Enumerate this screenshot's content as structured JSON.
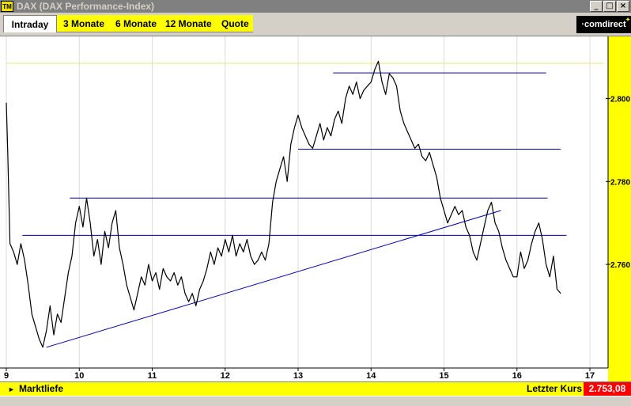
{
  "window": {
    "title": "DAX (DAX Performance-Index)",
    "icon": "TM",
    "controls": [
      "minimize",
      "maximize",
      "close"
    ]
  },
  "tabs": [
    {
      "label": "Intraday",
      "active": true
    },
    {
      "label": "3 Monate",
      "active": false
    },
    {
      "label": "6 Monate",
      "active": false
    },
    {
      "label": "12 Monate",
      "active": false
    },
    {
      "label": "Quote",
      "active": false
    }
  ],
  "logo": {
    "text": "·comdirect"
  },
  "colors": {
    "accent": "#ffff00",
    "price_line": "#000000",
    "trend_lines": "#0000aa",
    "value_badge": "#ff0000"
  },
  "chart_data": {
    "type": "line",
    "x_label": "",
    "y_label": "",
    "x_ticks": [
      "9",
      "10",
      "11",
      "12",
      "13",
      "14",
      "15",
      "16",
      "17"
    ],
    "y_ticks": [
      "2.760",
      "2.780",
      "2.800"
    ],
    "ylim": [
      2735,
      2815
    ],
    "xlim": [
      9,
      17
    ],
    "series": [
      {
        "points": [
          [
            9.0,
            2.799
          ],
          [
            9.02,
            2.787
          ],
          [
            9.05,
            2.765
          ],
          [
            9.1,
            2.763
          ],
          [
            9.15,
            2.76
          ],
          [
            9.2,
            2.765
          ],
          [
            9.25,
            2.761
          ],
          [
            9.3,
            2.755
          ],
          [
            9.35,
            2.748
          ],
          [
            9.4,
            2.745
          ],
          [
            9.45,
            2.742
          ],
          [
            9.5,
            2.74
          ],
          [
            9.55,
            2.744
          ],
          [
            9.6,
            2.75
          ],
          [
            9.65,
            2.743
          ],
          [
            9.7,
            2.748
          ],
          [
            9.75,
            2.746
          ],
          [
            9.8,
            2.752
          ],
          [
            9.85,
            2.758
          ],
          [
            9.9,
            2.762
          ],
          [
            9.95,
            2.77
          ],
          [
            10.0,
            2.774
          ],
          [
            10.05,
            2.769
          ],
          [
            10.1,
            2.776
          ],
          [
            10.15,
            2.77
          ],
          [
            10.2,
            2.762
          ],
          [
            10.25,
            2.766
          ],
          [
            10.3,
            2.76
          ],
          [
            10.35,
            2.768
          ],
          [
            10.4,
            2.764
          ],
          [
            10.45,
            2.77
          ],
          [
            10.5,
            2.773
          ],
          [
            10.55,
            2.764
          ],
          [
            10.6,
            2.76
          ],
          [
            10.65,
            2.755
          ],
          [
            10.7,
            2.752
          ],
          [
            10.75,
            2.749
          ],
          [
            10.8,
            2.753
          ],
          [
            10.85,
            2.757
          ],
          [
            10.9,
            2.755
          ],
          [
            10.95,
            2.76
          ],
          [
            11.0,
            2.756
          ],
          [
            11.05,
            2.758
          ],
          [
            11.1,
            2.754
          ],
          [
            11.15,
            2.759
          ],
          [
            11.2,
            2.757
          ],
          [
            11.25,
            2.756
          ],
          [
            11.3,
            2.758
          ],
          [
            11.35,
            2.755
          ],
          [
            11.4,
            2.757
          ],
          [
            11.45,
            2.753
          ],
          [
            11.5,
            2.751
          ],
          [
            11.55,
            2.753
          ],
          [
            11.6,
            2.75
          ],
          [
            11.65,
            2.754
          ],
          [
            11.7,
            2.756
          ],
          [
            11.75,
            2.759
          ],
          [
            11.8,
            2.763
          ],
          [
            11.85,
            2.76
          ],
          [
            11.9,
            2.764
          ],
          [
            11.95,
            2.762
          ],
          [
            12.0,
            2.766
          ],
          [
            12.05,
            2.763
          ],
          [
            12.1,
            2.767
          ],
          [
            12.15,
            2.762
          ],
          [
            12.2,
            2.765
          ],
          [
            12.25,
            2.763
          ],
          [
            12.3,
            2.766
          ],
          [
            12.35,
            2.762
          ],
          [
            12.4,
            2.76
          ],
          [
            12.45,
            2.761
          ],
          [
            12.5,
            2.763
          ],
          [
            12.55,
            2.761
          ],
          [
            12.6,
            2.765
          ],
          [
            12.65,
            2.775
          ],
          [
            12.7,
            2.78
          ],
          [
            12.75,
            2.783
          ],
          [
            12.8,
            2.786
          ],
          [
            12.85,
            2.78
          ],
          [
            12.9,
            2.789
          ],
          [
            12.95,
            2.793
          ],
          [
            13.0,
            2.796
          ],
          [
            13.05,
            2.793
          ],
          [
            13.1,
            2.791
          ],
          [
            13.15,
            2.789
          ],
          [
            13.2,
            2.788
          ],
          [
            13.25,
            2.791
          ],
          [
            13.3,
            2.794
          ],
          [
            13.35,
            2.79
          ],
          [
            13.4,
            2.793
          ],
          [
            13.45,
            2.791
          ],
          [
            13.5,
            2.795
          ],
          [
            13.55,
            2.797
          ],
          [
            13.6,
            2.794
          ],
          [
            13.65,
            2.8
          ],
          [
            13.7,
            2.803
          ],
          [
            13.75,
            2.801
          ],
          [
            13.8,
            2.804
          ],
          [
            13.85,
            2.8
          ],
          [
            13.9,
            2.802
          ],
          [
            13.95,
            2.803
          ],
          [
            14.0,
            2.804
          ],
          [
            14.05,
            2.807
          ],
          [
            14.1,
            2.809
          ],
          [
            14.15,
            2.804
          ],
          [
            14.2,
            2.801
          ],
          [
            14.25,
            2.806
          ],
          [
            14.3,
            2.805
          ],
          [
            14.35,
            2.803
          ],
          [
            14.4,
            2.797
          ],
          [
            14.45,
            2.794
          ],
          [
            14.5,
            2.792
          ],
          [
            14.55,
            2.79
          ],
          [
            14.6,
            2.788
          ],
          [
            14.65,
            2.789
          ],
          [
            14.7,
            2.786
          ],
          [
            14.75,
            2.785
          ],
          [
            14.8,
            2.787
          ],
          [
            14.85,
            2.784
          ],
          [
            14.9,
            2.781
          ],
          [
            14.95,
            2.776
          ],
          [
            15.0,
            2.773
          ],
          [
            15.05,
            2.77
          ],
          [
            15.1,
            2.772
          ],
          [
            15.15,
            2.774
          ],
          [
            15.2,
            2.772
          ],
          [
            15.25,
            2.773
          ],
          [
            15.3,
            2.769
          ],
          [
            15.35,
            2.767
          ],
          [
            15.4,
            2.763
          ],
          [
            15.45,
            2.761
          ],
          [
            15.5,
            2.765
          ],
          [
            15.55,
            2.769
          ],
          [
            15.6,
            2.773
          ],
          [
            15.65,
            2.775
          ],
          [
            15.7,
            2.77
          ],
          [
            15.75,
            2.768
          ],
          [
            15.8,
            2.764
          ],
          [
            15.85,
            2.761
          ],
          [
            15.9,
            2.759
          ],
          [
            15.95,
            2.757
          ],
          [
            16.0,
            2.757
          ],
          [
            16.05,
            2.763
          ],
          [
            16.1,
            2.759
          ],
          [
            16.15,
            2.761
          ],
          [
            16.2,
            2.765
          ],
          [
            16.25,
            2.768
          ],
          [
            16.3,
            2.77
          ],
          [
            16.35,
            2.766
          ],
          [
            16.4,
            2.76
          ],
          [
            16.45,
            2.757
          ],
          [
            16.5,
            2.762
          ],
          [
            16.55,
            2.754
          ],
          [
            16.6,
            2.753
          ]
        ]
      }
    ],
    "horizontal_lines": [
      {
        "y": 2.8085,
        "x_start": 9.0,
        "x_end": 17.2,
        "color": "#e8e870"
      },
      {
        "y": 2.8062,
        "x_start": 13.48,
        "x_end": 16.4,
        "color": "#0000aa"
      },
      {
        "y": 2.7878,
        "x_start": 13.0,
        "x_end": 16.6,
        "color": "#0000aa"
      },
      {
        "y": 2.776,
        "x_start": 9.87,
        "x_end": 16.42,
        "color": "#0000aa"
      },
      {
        "y": 2.767,
        "x_start": 9.22,
        "x_end": 16.68,
        "color": "#0000aa"
      }
    ],
    "trend_line": {
      "x_start": 9.55,
      "y_start": 2.74,
      "x_end": 15.78,
      "y_end": 2.773,
      "color": "#0000aa"
    },
    "grid": "vertical-only",
    "last_price": "2.753,08"
  },
  "footer": {
    "left_label": "Marktliefe",
    "right_label": "Letzter Kurs",
    "last_price": "2.753,08"
  }
}
